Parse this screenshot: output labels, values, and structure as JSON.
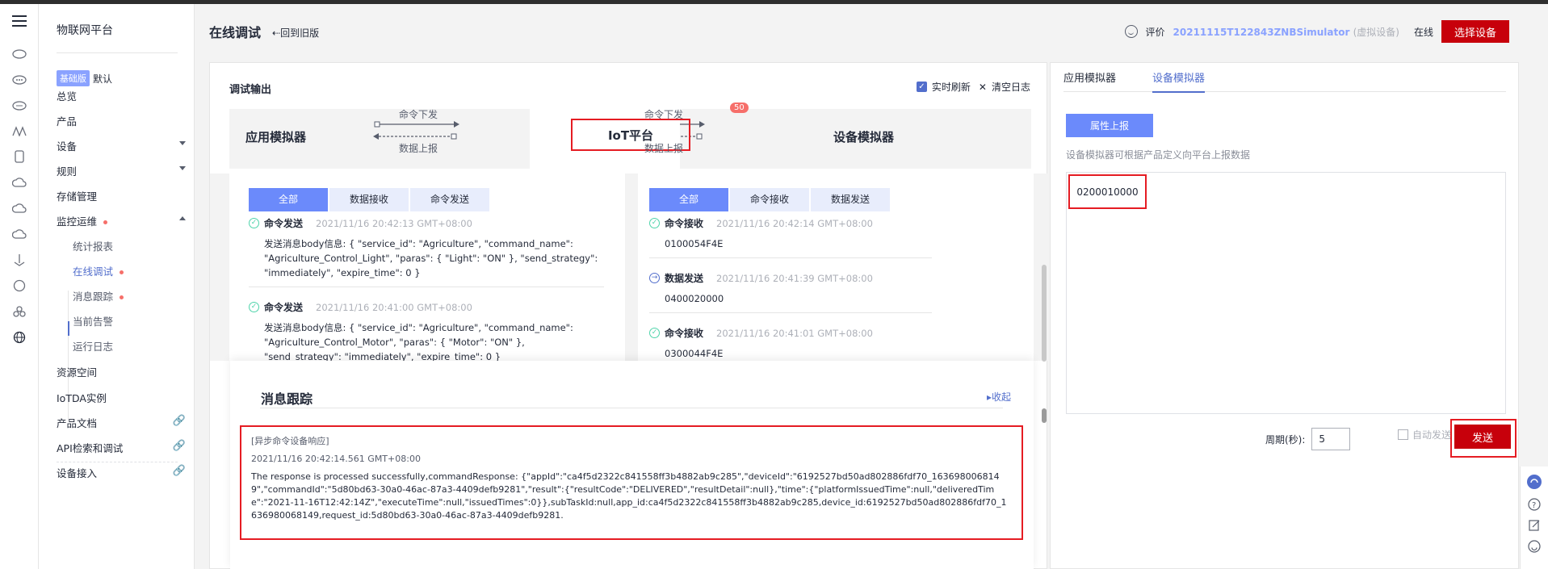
{
  "nav": {
    "title": "物联网平台",
    "edition_badge": "基础版",
    "edition_label": "默认",
    "items": [
      {
        "label": "总览"
      },
      {
        "label": "产品"
      },
      {
        "label": "设备"
      },
      {
        "label": "规则"
      },
      {
        "label": "存储管理"
      },
      {
        "label": "监控运维"
      },
      {
        "label": "统计报表"
      },
      {
        "label": "在线调试"
      },
      {
        "label": "消息跟踪"
      },
      {
        "label": "当前告警"
      },
      {
        "label": "运行日志"
      },
      {
        "label": "资源空间"
      },
      {
        "label": "IoTDA实例"
      },
      {
        "label": "产品文档"
      },
      {
        "label": "API检索和调试"
      },
      {
        "label": "设备接入"
      }
    ]
  },
  "header": {
    "title": "在线调试",
    "back_label": "回到旧版",
    "rate_label": "评价",
    "device_name": "20211115T122843ZNBSimulator",
    "device_tag": "(虚拟设备)",
    "status": "在线",
    "select_device": "选择设备"
  },
  "debug": {
    "title": "调试输出",
    "realtime_refresh": "实时刷新",
    "clear_log": "清空日志",
    "app_sim": "应用模拟器",
    "iot_platform": "IoT平台",
    "dev_sim": "设备模拟器",
    "cmd_down": "命令下发",
    "data_up": "数据上报",
    "badge_count": "50"
  },
  "left_tabs": [
    "全部",
    "数据接收",
    "命令发送"
  ],
  "right_tabs": [
    "全部",
    "命令接收",
    "数据发送"
  ],
  "left_entries": [
    {
      "kind": "命令发送",
      "time": "2021/11/16 20:42:13 GMT+08:00",
      "body": "发送消息body信息: { \"service_id\": \"Agriculture\", \"command_name\": \"Agriculture_Control_Light\", \"paras\": { \"Light\": \"ON\" }, \"send_strategy\": \"immediately\", \"expire_time\": 0 }"
    },
    {
      "kind": "命令发送",
      "time": "2021/11/16 20:41:00 GMT+08:00",
      "body": "发送消息body信息: { \"service_id\": \"Agriculture\", \"command_name\": \"Agriculture_Control_Motor\", \"paras\": { \"Motor\": \"ON\" }, \"send_strategy\": \"immediately\", \"expire_time\": 0 }"
    }
  ],
  "right_entries": [
    {
      "kind": "命令接收",
      "time": "2021/11/16 20:42:14 GMT+08:00",
      "body": "0100054F4E"
    },
    {
      "kind": "数据发送",
      "time": "2021/11/16 20:41:39 GMT+08:00",
      "body": "0400020000"
    },
    {
      "kind": "命令接收",
      "time": "2021/11/16 20:41:01 GMT+08:00",
      "body": "0300044F4E"
    }
  ],
  "trace": {
    "title": "消息跟踪",
    "collapse": "收起",
    "msg_type": "[异步命令设备响应]",
    "msg_time": "2021/11/16 20:42:14.561 GMT+08:00",
    "msg_text": "The response is processed successfully,commandResponse: {\"appId\":\"ca4f5d2322c841558ff3b4882ab9c285\",\"deviceId\":\"6192527bd50ad802886fdf70_1636980068149\",\"commandId\":\"5d80bd63-30a0-46ac-87a3-4409defb9281\",\"result\":{\"resultCode\":\"DELIVERED\",\"resultDetail\":null},\"time\":{\"platformIssuedTime\":null,\"deliveredTime\":\"2021-11-16T12:42:14Z\",\"executeTime\":null,\"issuedTimes\":0}},subTaskId:null,app_id:ca4f5d2322c841558ff3b4882ab9c285,device_id:6192527bd50ad802886fdf70_1636980068149,request_id:5d80bd63-30a0-46ac-87a3-4409defb9281."
  },
  "rpanel": {
    "tab_app": "应用模拟器",
    "tab_dev": "设备模拟器",
    "report_btn": "属性上报",
    "hint": "设备模拟器可根据产品定义向平台上报数据",
    "input_value": "0200010000",
    "period_label": "周期(秒):",
    "period_value": "5",
    "auto_send": "自动发送",
    "send": "发送"
  },
  "colors": {
    "accent": "#526ecc",
    "danger": "#c7000b",
    "highlight_box": "#e51c23",
    "success": "#50d4ab"
  }
}
